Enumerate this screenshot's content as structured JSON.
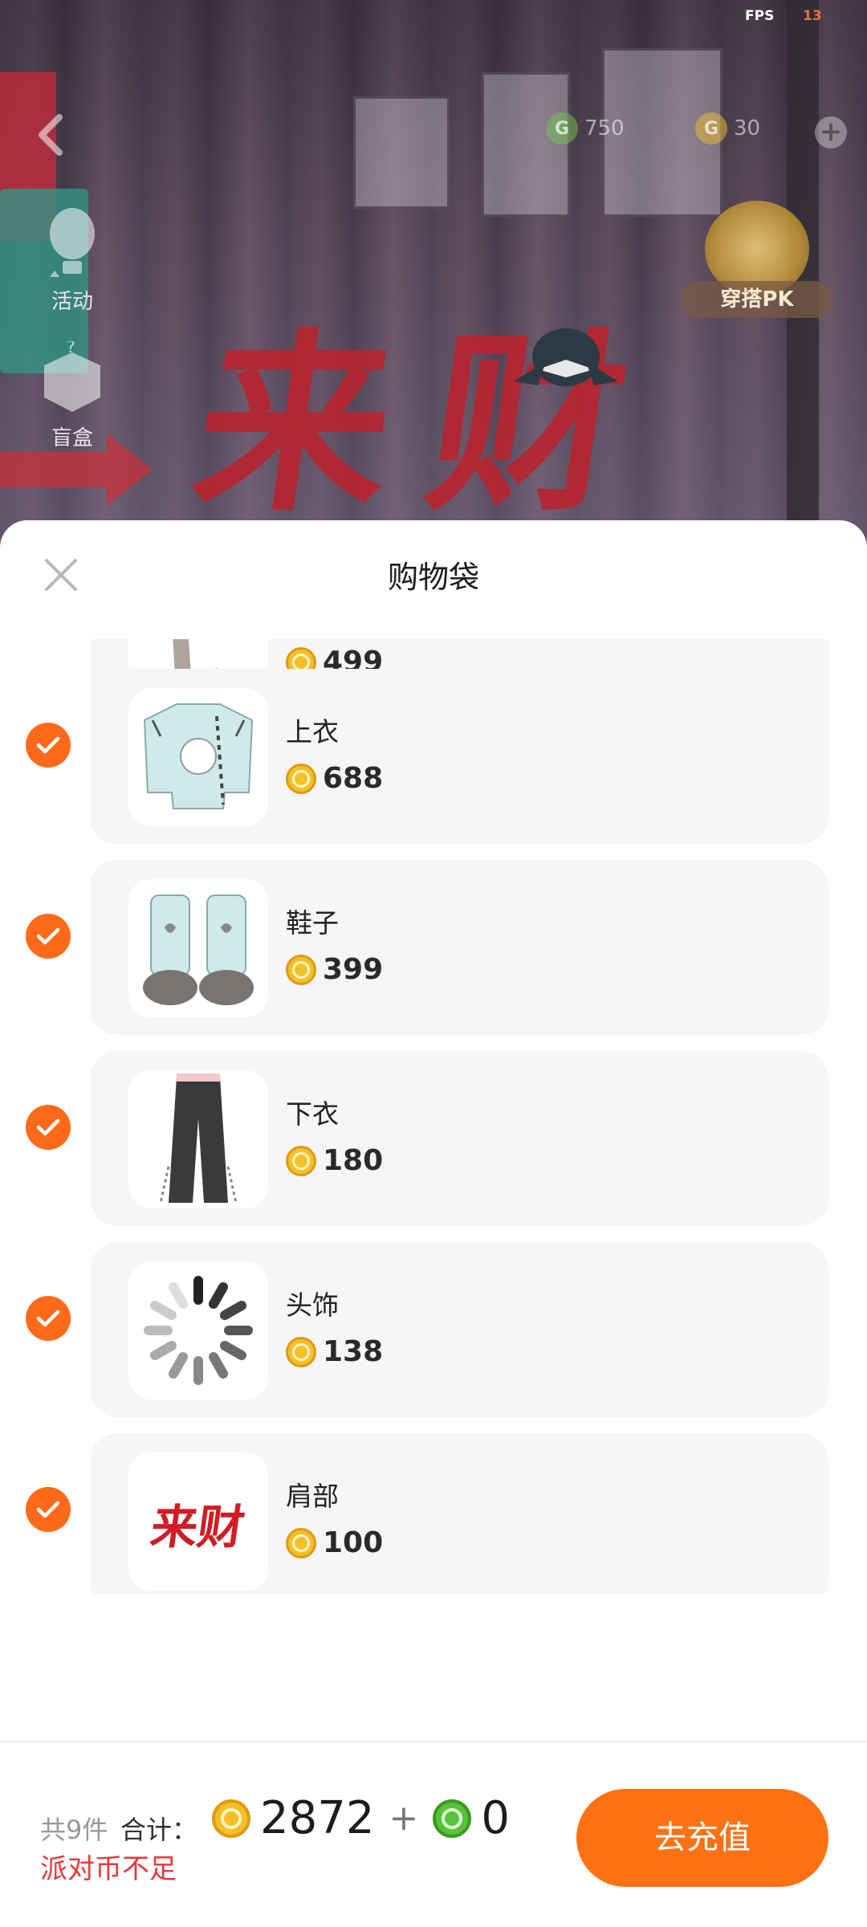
{
  "status": {
    "fps_label": "FPS",
    "fps_value": "13"
  },
  "scene": {
    "currency_green": "750",
    "currency_gold": "30",
    "activity_label": "活动",
    "blindbox_label": "盲盒",
    "pk_label": "穿搭PK",
    "sign_text": "来财"
  },
  "sheet": {
    "title": "购物袋",
    "items": [
      {
        "name": "",
        "price": "499",
        "checked": true
      },
      {
        "name": "上衣",
        "price": "688",
        "checked": true
      },
      {
        "name": "鞋子",
        "price": "399",
        "checked": true
      },
      {
        "name": "下衣",
        "price": "180",
        "checked": true
      },
      {
        "name": "头饰",
        "price": "138",
        "checked": true
      },
      {
        "name": "肩部",
        "price": "100",
        "checked": true
      }
    ],
    "shoulder_thumb_text": "来财"
  },
  "footer": {
    "count_label": "共9件",
    "sum_label": "合计：",
    "total_gold": "2872",
    "plus": "+",
    "total_green": "0",
    "warning": "派对币不足",
    "recharge_label": "去充值"
  },
  "colors": {
    "accent": "#ff7112",
    "warning": "#e8383a",
    "check": "#ff6a1a"
  }
}
